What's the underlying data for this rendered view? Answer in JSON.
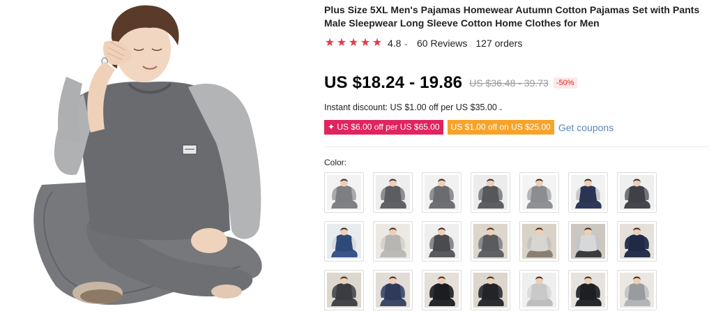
{
  "product": {
    "title": "Plus Size 5XL Men's Pajamas Homewear Autumn Cotton Pajamas Set with Pants Male Sleepwear Long Sleeve Cotton Home Clothes for Men",
    "main_image_icon": "product-photo-man-gray-pajamas"
  },
  "rating": {
    "stars_count": 5,
    "star_glyph": "★",
    "value": "4.8",
    "caret": "⌄",
    "reviews": "60 Reviews",
    "orders": "127 orders",
    "star_color": "#e13c4a"
  },
  "price": {
    "current": "US $18.24 - 19.86",
    "original": "US $36.48 - 39.73",
    "discount": "-50%"
  },
  "instant_discount": {
    "text": "Instant discount: US $1.00 off per US $35.00",
    "caret": "⌄"
  },
  "coupons": {
    "items": [
      {
        "text": "✦ US $6.00 off per US $65.00",
        "color": "#e0245f"
      },
      {
        "text": "US $1.00 off on US $25.00",
        "color": "#f7a32a"
      }
    ],
    "get_label": "Get coupons"
  },
  "color_section": {
    "label": "Color:",
    "variants": [
      {
        "shirt": "#7d7f83",
        "sleeve": "#a9aaac",
        "pants": "#7f8185",
        "bg": "#f3f3f3"
      },
      {
        "shirt": "#5c5d60",
        "sleeve": "#8d8e90",
        "pants": "#606164",
        "bg": "#eeeeee"
      },
      {
        "shirt": "#6b6c6f",
        "sleeve": "#8e9093",
        "pants": "#6e6f72",
        "bg": "#f1f1f1"
      },
      {
        "shirt": "#55575a",
        "sleeve": "#87898c",
        "pants": "#5c5e61",
        "bg": "#ececec"
      },
      {
        "shirt": "#8b8d90",
        "sleeve": "#b5b6b8",
        "pants": "#8f9194",
        "bg": "#f4f4f4"
      },
      {
        "shirt": "#2b3553",
        "sleeve": "#c7c9cc",
        "pants": "#2e3858",
        "bg": "#f1f1f1"
      },
      {
        "shirt": "#3f4147",
        "sleeve": "#73757a",
        "pants": "#45474c",
        "bg": "#efefef"
      },
      {
        "shirt": "#2e4a7a",
        "sleeve": "#d8d9db",
        "pants": "#3a5688",
        "bg": "#e8ecef"
      },
      {
        "shirt": "#b8b6b2",
        "sleeve": "#d5d3cf",
        "pants": "#bcbab6",
        "bg": "#ece9e4"
      },
      {
        "shirt": "#4a4b4e",
        "sleeve": "#8a8b8e",
        "pants": "#5a5b5e",
        "bg": "#efefef"
      },
      {
        "shirt": "#5a5b5e",
        "sleeve": "#8a8b8e",
        "pants": "#606164",
        "bg": "#dcd6cc"
      },
      {
        "shirt": "#d8d6d2",
        "sleeve": "#c5c3bf",
        "pants": "#8a7f74",
        "bg": "#d9d2c6"
      },
      {
        "shirt": "#d7d8da",
        "sleeve": "#c4c5c8",
        "pants": "#3a3b3e",
        "bg": "#ccc7c0"
      },
      {
        "shirt": "#1f2a45",
        "sleeve": "#2a3553",
        "pants": "#27314d",
        "bg": "#e5e1da"
      },
      {
        "shirt": "#3b3c3f",
        "sleeve": "#55565a",
        "pants": "#44454a",
        "bg": "#ddd7cd"
      },
      {
        "shirt": "#2f3a5a",
        "sleeve": "#475374",
        "pants": "#3b4767",
        "bg": "#e1ddd6"
      },
      {
        "shirt": "#1c1d20",
        "sleeve": "#2e2f33",
        "pants": "#26272a",
        "bg": "#e4e0d9"
      },
      {
        "shirt": "#232427",
        "sleeve": "#3a3b3f",
        "pants": "#2c2d30",
        "bg": "#dcd6cc"
      },
      {
        "shirt": "#c9c9c9",
        "sleeve": "#dcdcdc",
        "pants": "#bdbdbd",
        "bg": "#efefef"
      },
      {
        "shirt": "#1e1f22",
        "sleeve": "#2f3034",
        "pants": "#28292c",
        "bg": "#e6e3de"
      },
      {
        "shirt": "#9a9b9e",
        "sleeve": "#c4c5c7",
        "pants": "#b3b4b6",
        "bg": "#ebe7e1"
      }
    ]
  }
}
